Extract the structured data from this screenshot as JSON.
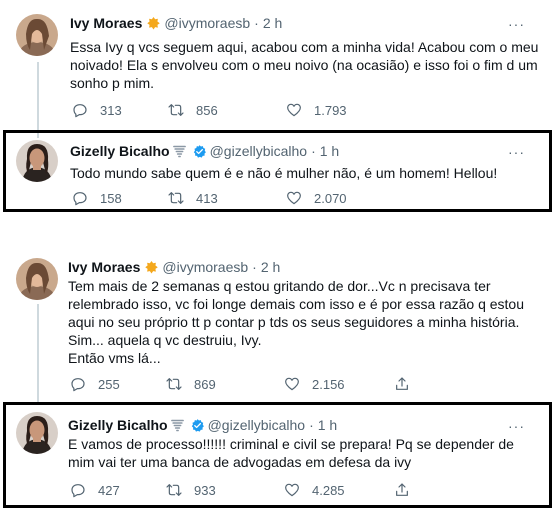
{
  "threads": [
    {
      "parent": {
        "name": "Ivy Moraes",
        "handle": "@ivymoraesb",
        "separator": "·",
        "time": "2 h",
        "badge": "star-badge",
        "text": "Essa Ivy q vcs seguem aqui, acabou com a minha vida! Acabou com o meu\nnoivado! Ela s envolveu com o meu noivo (na ocasião) e isso foi o fim d um\nsonho p mim.",
        "replies": "313",
        "retweets": "856",
        "likes": "1.793",
        "more": "···"
      },
      "reply": {
        "name": "Gizelly Bicalho",
        "handle": "@gizellybicalho",
        "separator": "·",
        "time": "1 h",
        "badge": "verified-badge",
        "text": "Todo mundo sabe quem é e não é mulher não, é um homem! Hellou!",
        "replies": "158",
        "retweets": "413",
        "likes": "2.070",
        "more": "···"
      }
    },
    {
      "parent": {
        "name": "Ivy Moraes",
        "handle": "@ivymoraesb",
        "separator": "·",
        "time": "2 h",
        "badge": "star-badge",
        "text": "Tem mais de 2 semanas q estou gritando de dor...Vc n precisava ter\nrelembrado isso, vc foi longe demais com isso e é por essa razão q estou\naqui no seu próprio tt p contar p tds os seus seguidores a minha história.\nSim... aquela q vc destruiu, Ivy.\nEntão vms lá...",
        "replies": "255",
        "retweets": "869",
        "likes": "2.156",
        "more": "···"
      },
      "reply": {
        "name": "Gizelly Bicalho",
        "handle": "@gizellybicalho",
        "separator": "·",
        "time": "1 h",
        "badge": "verified-badge",
        "text": "E vamos de processo!!!!!! criminal e civil se prepara! Pq se depender de\nmim vai ter uma banca de advogadas em defesa da ivy",
        "replies": "427",
        "retweets": "933",
        "likes": "4.285",
        "more": "···"
      }
    }
  ],
  "colors": {
    "text": "#0f1419",
    "secondary": "#536471",
    "verified": "#1d9bf0",
    "star": "#f4a81d",
    "thread_line": "#cfd9de",
    "highlight_border": "#000000"
  }
}
